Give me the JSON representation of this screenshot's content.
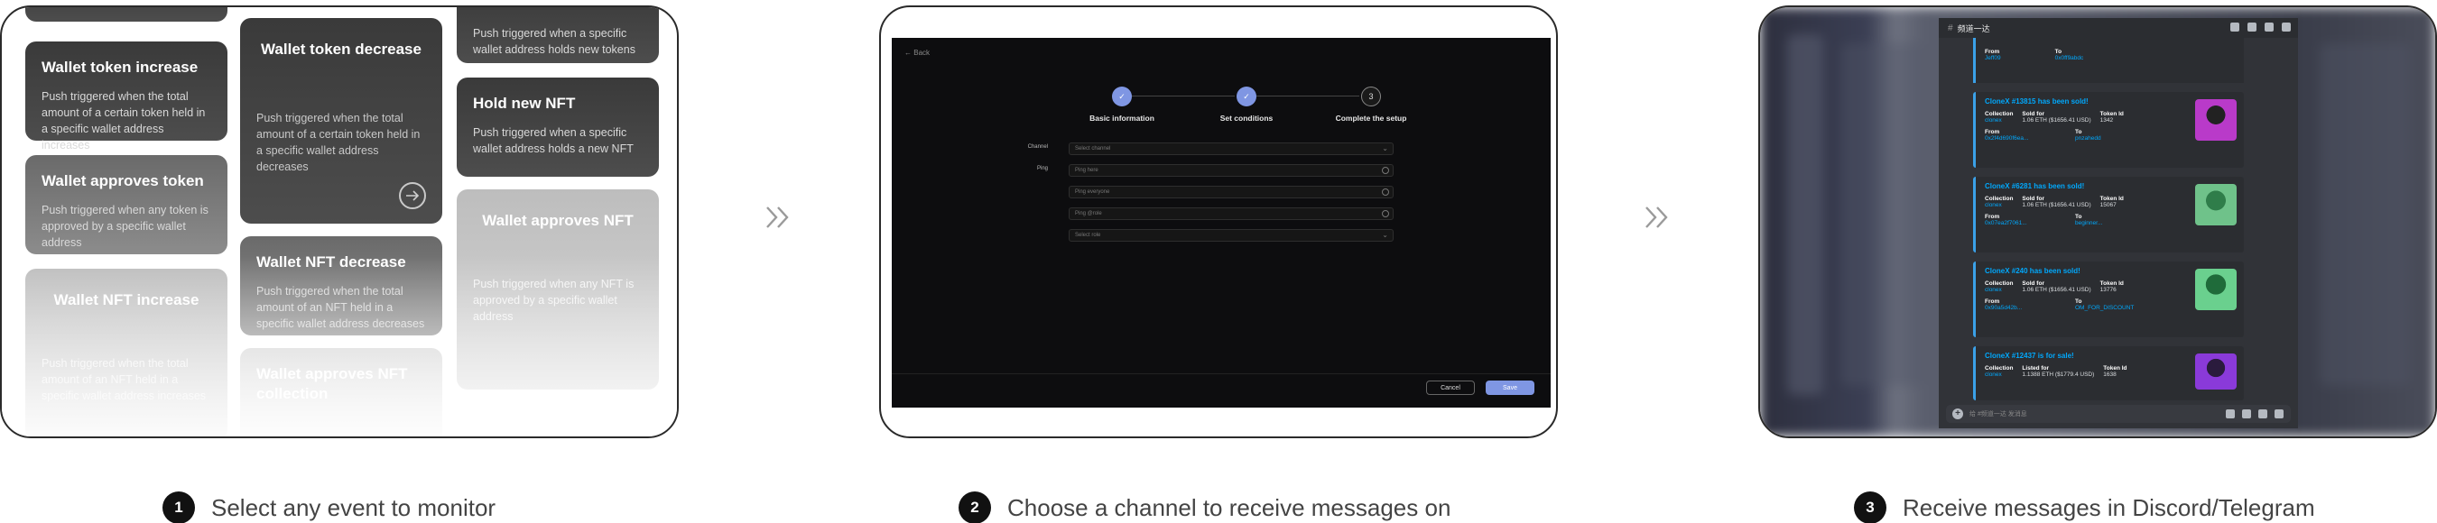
{
  "steps": [
    {
      "num": "1",
      "text": "Select any event to monitor"
    },
    {
      "num": "2",
      "text": "Choose a channel to receive messages on"
    },
    {
      "num": "3",
      "text": "Receive messages in Discord/Telegram"
    }
  ],
  "panel1": {
    "top_fragment": "Push triggered when a specific wallet address holds new tokens",
    "cards": [
      {
        "title": "Wallet token increase",
        "desc": "Push triggered when the total amount of a certain token held in a specific wallet address increases"
      },
      {
        "title": "Wallet approves token",
        "desc": "Push triggered when any token is approved by a specific wallet address"
      },
      {
        "title": "Wallet NFT increase",
        "desc": "Push triggered when the total amount of an NFT held in a specific wallet address increases"
      },
      {
        "title": "Wallet token decrease",
        "desc": "Push triggered when the total amount of a certain token held in a specific wallet address decreases"
      },
      {
        "title": "Wallet NFT decrease",
        "desc": "Push triggered when the total amount of an NFT held in a specific wallet address decreases"
      },
      {
        "title": "Wallet approves NFT collection",
        "desc": ""
      },
      {
        "title": "Hold new NFT",
        "desc": "Push triggered when a specific wallet address holds a new NFT"
      },
      {
        "title": "Wallet approves NFT",
        "desc": "Push triggered when any NFT is approved by a specific wallet address"
      }
    ]
  },
  "panel2": {
    "back": "Back",
    "stepper": [
      {
        "label": "Basic information",
        "mark": "✓"
      },
      {
        "label": "Set conditions",
        "mark": "✓"
      },
      {
        "label": "Complete the setup",
        "mark": "3"
      }
    ],
    "labels": {
      "channel": "Channel",
      "ping": "Ping"
    },
    "placeholders": {
      "select": "Select channel",
      "here": "Ping here",
      "everyone": "Ping everyone",
      "role": "Ping @role",
      "select2": "Select role"
    },
    "cancel": "Cancel",
    "save": "Save"
  },
  "panel3": {
    "channel": "频道一达",
    "partial_from": "From",
    "partial_to": "To",
    "partial_from_val": "Jeff09",
    "partial_to_val": "0x0ff9abdc",
    "messages": [
      {
        "title": "CloneX #13815 has been sold!",
        "col_label": "Collection",
        "col_val": "clonex",
        "mid_label": "Sold for",
        "mid_val": "1.06 ETH ($1656.41 USD)",
        "id_label": "Token Id",
        "id_val": "1342",
        "from_label": "From",
        "from_val": "0x2f4d690f6ea...",
        "to_label": "To",
        "to_val": "pnzahedd"
      },
      {
        "title": "CloneX #6281 has been sold!",
        "col_label": "Collection",
        "col_val": "clonex",
        "mid_label": "Sold for",
        "mid_val": "1.06 ETH ($1656.41 USD)",
        "id_label": "Token Id",
        "id_val": "15067",
        "from_label": "From",
        "from_val": "0x07ea2f7061...",
        "to_label": "To",
        "to_val": "beginner..."
      },
      {
        "title": "CloneX #240 has been sold!",
        "col_label": "Collection",
        "col_val": "clonex",
        "mid_label": "Sold for",
        "mid_val": "1.06 ETH ($1656.41 USD)",
        "id_label": "Token Id",
        "id_val": "13776",
        "from_label": "From",
        "from_val": "0x90a5d42b...",
        "to_label": "To",
        "to_val": "OM_FOR_DISCOUNT"
      },
      {
        "title": "CloneX #12437 is for sale!",
        "col_label": "Collection",
        "col_val": "clonex",
        "mid_label": "Listed for",
        "mid_val": "1.1388 ETH ($1779.4 USD)",
        "id_label": "Token Id",
        "id_val": "1638",
        "from_label": "",
        "from_val": "",
        "to_label": "",
        "to_val": ""
      }
    ],
    "input_placeholder": "给 #频道一达 发消息"
  }
}
